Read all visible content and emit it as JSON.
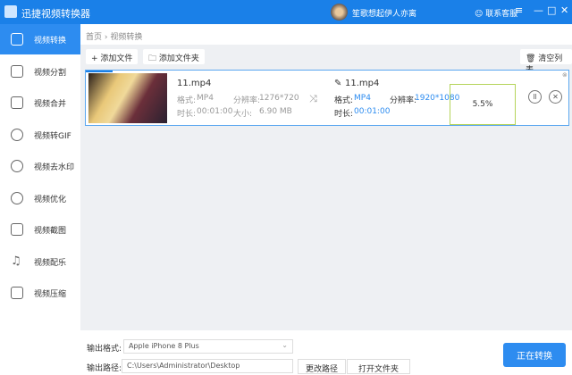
{
  "app": {
    "title": "迅捷视频转换器",
    "user": "笙歌想起伊人亦离",
    "support": "联系客服",
    "menu_icon": "menu-icon",
    "min": "—",
    "max": "□",
    "close": "✕"
  },
  "sidebar": {
    "items": [
      {
        "label": "视频转换",
        "active": true
      },
      {
        "label": "视频分割"
      },
      {
        "label": "视频合并"
      },
      {
        "label": "视频转GIF"
      },
      {
        "label": "视频去水印"
      },
      {
        "label": "视频优化"
      },
      {
        "label": "视频截图"
      },
      {
        "label": "视频配乐"
      },
      {
        "label": "视频压缩"
      }
    ]
  },
  "breadcrumb": {
    "home": "首页",
    "sep": " › ",
    "current": "视频转换"
  },
  "toolbar": {
    "add_file": "+ 添加文件",
    "add_folder": "🗀 添加文件夹",
    "clear": "🗑 清空列表"
  },
  "file": {
    "source": {
      "name": "11.mp4",
      "format_label": "格式:",
      "format": "MP4",
      "res_label": "分辨率:",
      "res": "1276*720",
      "dur_label": "时长:",
      "dur": "00:01:00",
      "size_label": "大小:",
      "size": "6.90 MB"
    },
    "target": {
      "name": "11.mp4",
      "format_label": "格式:",
      "format": "MP4",
      "res_label": "分辨率:",
      "res": "1920*1080",
      "dur_label": "时长:",
      "dur": "00:01:00"
    },
    "progress_text": "5.5%",
    "progress": 5.5
  },
  "bottom": {
    "format_label": "输出格式:",
    "format_value": "Apple  iPhone 8 Plus",
    "path_label": "输出路径:",
    "path_value": "C:\\Users\\Administrator\\Desktop",
    "change_path": "更改路径",
    "open_folder": "打开文件夹",
    "convert": "正在转换"
  },
  "colors": {
    "accent": "#2d8cf0",
    "titlebar": "#1a80e8",
    "progress_border": "#b5d45a"
  }
}
